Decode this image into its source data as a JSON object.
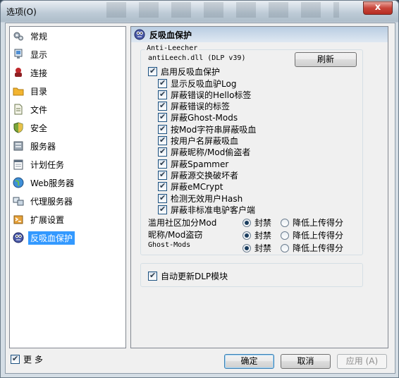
{
  "window": {
    "title": "选项(O)",
    "close": "x"
  },
  "sidebar": {
    "items": [
      {
        "label": "常规",
        "icon": "gear-icon"
      },
      {
        "label": "显示",
        "icon": "monitor-icon"
      },
      {
        "label": "连接",
        "icon": "connection-icon"
      },
      {
        "label": "目录",
        "icon": "folder-icon"
      },
      {
        "label": "文件",
        "icon": "file-icon"
      },
      {
        "label": "安全",
        "icon": "shield-icon"
      },
      {
        "label": "服务器",
        "icon": "server-icon"
      },
      {
        "label": "计划任务",
        "icon": "calendar-icon"
      },
      {
        "label": "Web服务器",
        "icon": "globe-icon"
      },
      {
        "label": "代理服务器",
        "icon": "proxy-icon"
      },
      {
        "label": "扩展设置",
        "icon": "puzzle-icon"
      },
      {
        "label": "反吸血保护",
        "icon": "antileech-icon"
      }
    ],
    "selected_index": 11,
    "more_label": "更 多"
  },
  "main": {
    "header": "反吸血保护",
    "group_title": "Anti-Leecher",
    "dll_label": "antiLeech.dll (DLP v39)",
    "refresh_button": "刷新",
    "enable_label": "启用反吸血保护",
    "options": [
      "显示反吸血驴Log",
      "屏蔽错误的Hello标签",
      "屏蔽错误的标签",
      "屏蔽Ghost-Mods",
      "按Mod字符串屏蔽吸血",
      "按用户名屏蔽吸血",
      "屏蔽昵称/Mod偷盗者",
      "屏蔽Spammer",
      "屏蔽源交换破坏者",
      "屏蔽eMCrypt",
      "检测无效用户Hash",
      "屏蔽非标准电驴客户端"
    ],
    "radio_rows": [
      {
        "label": "滥用社区加分Mod",
        "opt1": "封禁",
        "opt2": "降低上传得分"
      },
      {
        "label": "昵称/Mod盗窃",
        "opt1": "封禁",
        "opt2": "降低上传得分"
      },
      {
        "label": "Ghost-Mods",
        "opt1": "封禁",
        "opt2": "降低上传得分"
      }
    ],
    "auto_update_label": "自动更新DLP模块"
  },
  "footer": {
    "ok": "确定",
    "cancel": "取消",
    "apply": "应用 (A)"
  }
}
